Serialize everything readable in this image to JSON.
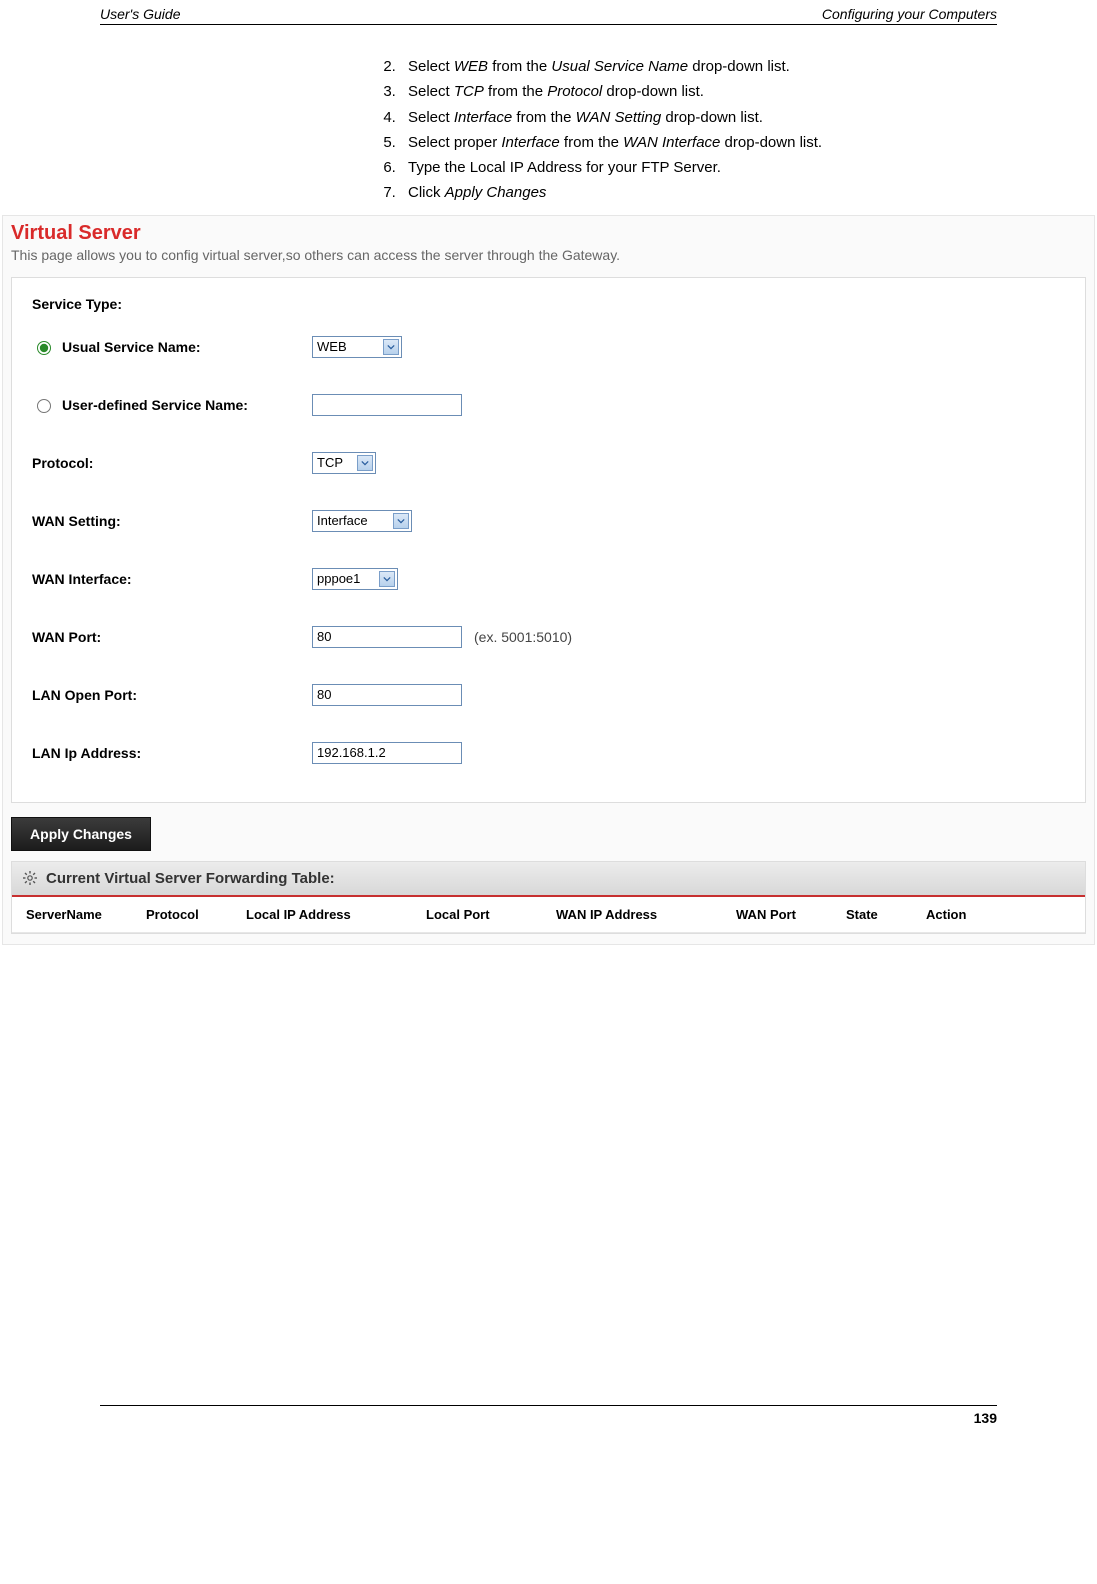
{
  "header": {
    "left": "User's Guide",
    "right": "Configuring your Computers"
  },
  "instructions": [
    {
      "n": "2.",
      "prefix": "Select ",
      "i1": "WEB",
      "mid": " from the ",
      "i2": "Usual Service Name",
      "suffix": " drop-down list."
    },
    {
      "n": "3.",
      "prefix": "Select ",
      "i1": "TCP",
      "mid": " from the ",
      "i2": "Protocol",
      "suffix": " drop-down list."
    },
    {
      "n": "4.",
      "prefix": "Select ",
      "i1": "Interface",
      "mid": " from the ",
      "i2": "WAN Setting",
      "suffix": " drop-down list."
    },
    {
      "n": "5.",
      "prefix": "Select proper ",
      "i1": "Interface",
      "mid": " from the ",
      "i2": "WAN Interface",
      "suffix": " drop-down list."
    },
    {
      "n": "6.",
      "prefix": "Type the Local IP Address for your FTP Server.",
      "i1": "",
      "mid": "",
      "i2": "",
      "suffix": ""
    },
    {
      "n": "7.",
      "prefix": "Click ",
      "i1": "Apply Changes",
      "mid": "",
      "i2": "",
      "suffix": ""
    }
  ],
  "vs": {
    "title": "Virtual Server",
    "desc": "This page allows you to config virtual server,so others can access the server through the Gateway.",
    "section_heading": "Service Type:",
    "rows": {
      "usual_label": "Usual Service Name:",
      "usual_value": "WEB",
      "userdef_label": "User-defined Service Name:",
      "userdef_value": "",
      "protocol_label": "Protocol:",
      "protocol_value": "TCP",
      "wan_setting_label": "WAN Setting:",
      "wan_setting_value": "Interface",
      "wan_iface_label": "WAN Interface:",
      "wan_iface_value": "pppoe1",
      "wan_port_label": "WAN Port:",
      "wan_port_value": "80",
      "wan_port_hint": "(ex. 5001:5010)",
      "lan_port_label": "LAN Open Port:",
      "lan_port_value": "80",
      "lan_ip_label": "LAN Ip Address:",
      "lan_ip_value": "192.168.1.2"
    },
    "apply_label": "Apply Changes",
    "table_title": "Current Virtual Server Forwarding Table:",
    "cols": [
      "ServerName",
      "Protocol",
      "Local IP Address",
      "Local Port",
      "WAN IP Address",
      "WAN Port",
      "State",
      "Action"
    ]
  },
  "footer": {
    "page_no": "139"
  }
}
